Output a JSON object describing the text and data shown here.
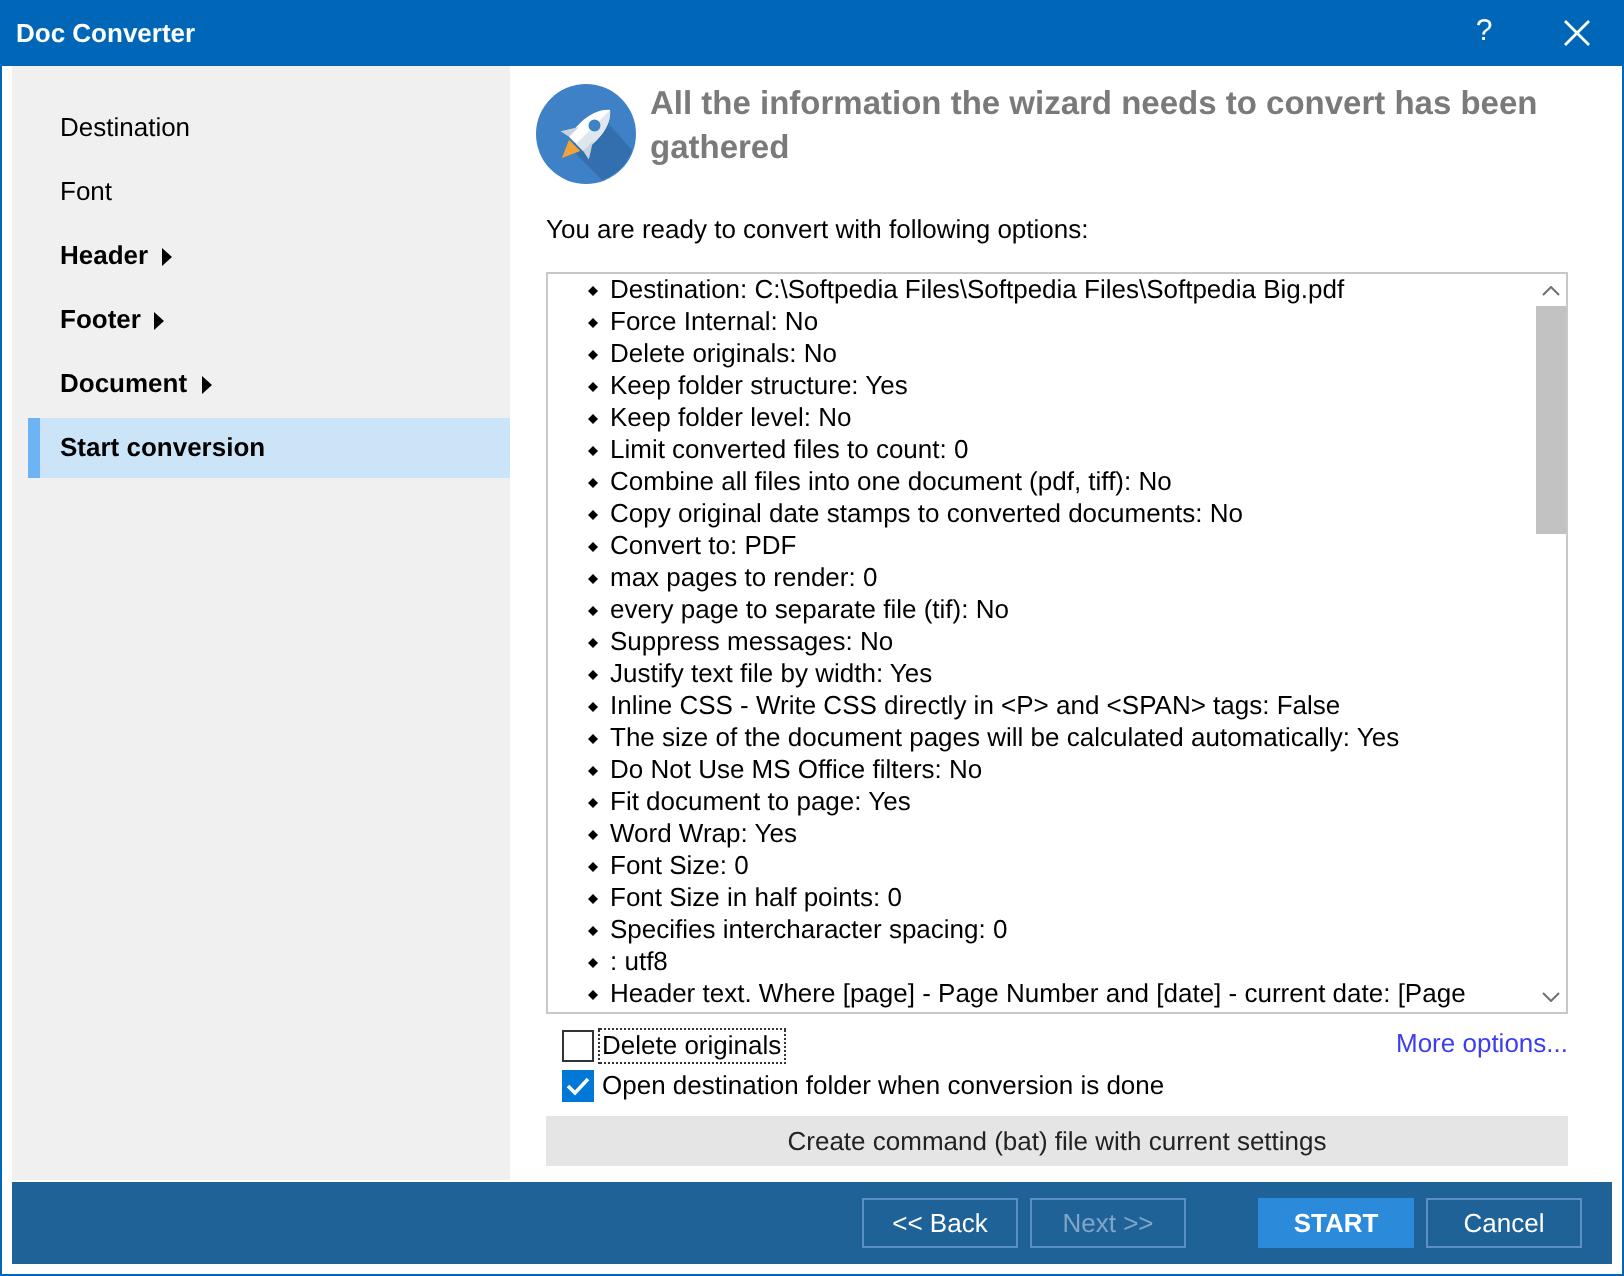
{
  "window": {
    "title": "Doc Converter",
    "help_button": "?"
  },
  "sidebar": {
    "items": [
      {
        "label": "Destination",
        "kind": "page",
        "selected": false
      },
      {
        "label": "Font",
        "kind": "page",
        "selected": false
      },
      {
        "label": "Header",
        "kind": "section",
        "selected": false
      },
      {
        "label": "Footer",
        "kind": "section",
        "selected": false
      },
      {
        "label": "Document",
        "kind": "section",
        "selected": false
      },
      {
        "label": "Start conversion",
        "kind": "page",
        "selected": true
      }
    ]
  },
  "header": {
    "title": "All the information the wizard needs to convert has been gathered"
  },
  "intro": "You are ready to convert with following options:",
  "options_list": {
    "items": [
      "Destination: C:\\Softpedia Files\\Softpedia Files\\Softpedia Big.pdf",
      "Force Internal: No",
      "Delete originals: No",
      "Keep folder structure: Yes",
      "Keep folder level: No",
      "Limit converted files to count: 0",
      "Combine all files into one document (pdf, tiff): No",
      "Copy original date stamps to converted documents: No",
      "Convert to: PDF",
      "max pages to render: 0",
      "every page to separate file (tif): No",
      "Suppress messages: No",
      "Justify text file by width: Yes",
      "Inline CSS - Write CSS directly in <P> and <SPAN> tags: False",
      "The size of the document pages will be calculated automatically: Yes",
      "Do Not Use MS Office filters: No",
      "Fit document to page: Yes",
      "Word Wrap: Yes",
      "Font Size: 0",
      "Font Size in half points: 0",
      "Specifies intercharacter spacing: 0",
      ": utf8",
      "Header text. Where [page] - Page Number and [date] - current date: [Page"
    ]
  },
  "checkboxes": [
    {
      "label": "Delete originals",
      "checked": false,
      "focused": true
    },
    {
      "label": "Open destination folder when conversion is done",
      "checked": true,
      "focused": false
    }
  ],
  "more_options_link": "More options...",
  "command_button": "Create command (bat) file with current settings",
  "footer_buttons": [
    {
      "label": "<< Back",
      "kind": "outline",
      "disabled": false
    },
    {
      "label": "Next >>",
      "kind": "outline",
      "disabled": true
    },
    {
      "label": "START",
      "kind": "primary",
      "disabled": false
    },
    {
      "label": "Cancel",
      "kind": "outline",
      "disabled": false
    }
  ]
}
